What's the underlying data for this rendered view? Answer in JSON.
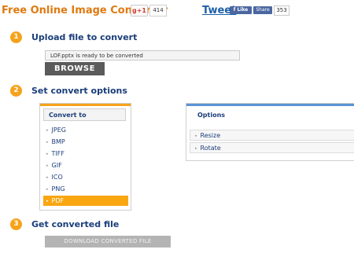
{
  "header": {
    "title": "Free Online Image Converter",
    "gplus_label": "g+1",
    "gplus_count": "414",
    "tweet_label": "Tweet",
    "fb_like_label": "Like",
    "fb_share_label": "Share",
    "fb_count": "353"
  },
  "steps": [
    {
      "number": "1",
      "label": "Upload file to convert"
    },
    {
      "number": "2",
      "label": "Set convert options"
    },
    {
      "number": "3",
      "label": "Get converted file"
    }
  ],
  "upload": {
    "status_text": "LOF.pptx is ready to be converted",
    "browse_label": "BROWSE"
  },
  "convert_to": {
    "header": "Convert to",
    "formats": [
      "JPEG",
      "BMP",
      "TIFF",
      "GIF",
      "ICO",
      "PNG",
      "PDF"
    ],
    "selected": "PDF"
  },
  "options": {
    "header": "Options",
    "items": [
      "Resize",
      "Rotate"
    ]
  },
  "download": {
    "label": "DOWNLOAD CONVERTED FILE"
  },
  "colors": {
    "accent_orange": "#f7a21b",
    "title_orange": "#e07a10",
    "link_blue": "#1a3d7a",
    "options_blue": "#5b92d4"
  }
}
